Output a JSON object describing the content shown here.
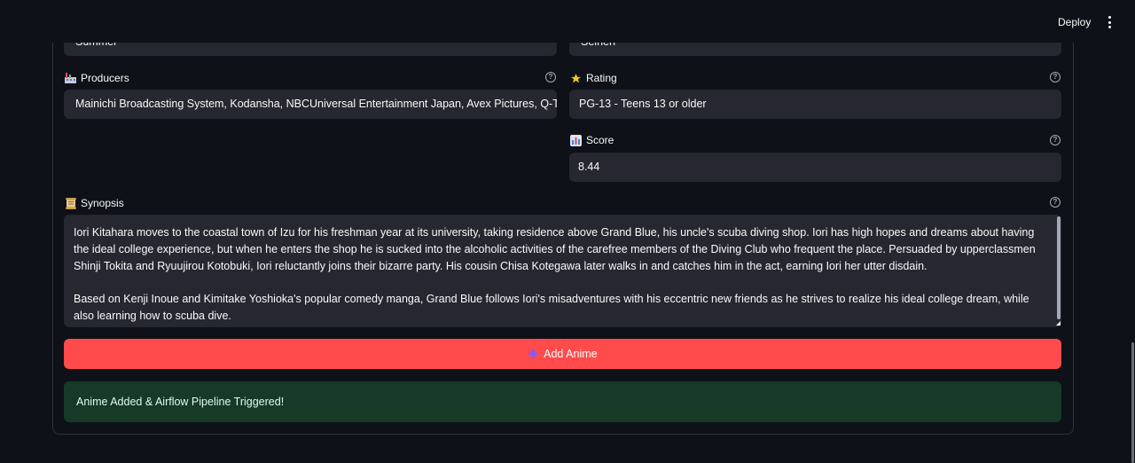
{
  "header": {
    "deploy_label": "Deploy"
  },
  "fields": {
    "season_value": "Summer",
    "demographic_value": "Seinen",
    "producers": {
      "icon": "factory-icon",
      "label": "Producers",
      "value": "Mainichi Broadcasting System, Kodansha, NBCUniversal Entertainment Japan, Avex Pictures, Q-Tec"
    },
    "rating": {
      "icon": "star-icon",
      "label": "Rating",
      "value": "PG-13 - Teens 13 or older"
    },
    "score": {
      "icon": "bar-chart-icon",
      "label": "Score",
      "value": "8.44"
    },
    "synopsis": {
      "icon": "scroll-icon",
      "label": "Synopsis",
      "paragraph1": "Iori Kitahara moves to the coastal town of Izu for his freshman year at its university, taking residence above Grand Blue, his uncle's scuba diving shop. Iori has high hopes and dreams about having the ideal college experience, but when he enters the shop he is sucked into the alcoholic activities of the carefree members of the Diving Club who frequent the place. Persuaded by upperclassmen Shinji Tokita and Ryuujirou Kotobuki, Iori reluctantly joins their bizarre party. His cousin Chisa Kotegawa later walks in and catches him in the act, earning Iori her utter disdain.",
      "paragraph2": "Based on Kenji Inoue and Kimitake Yoshioka's popular comedy manga, Grand Blue follows Iori's misadventures with his eccentric new friends as he strives to realize his ideal college dream, while also learning how to scuba dive."
    }
  },
  "actions": {
    "add_label": "Add Anime",
    "add_icon": "plus-icon"
  },
  "status": {
    "success_message": "Anime Added & Airflow Pipeline Triggered!"
  },
  "colors": {
    "background": "#0e1117",
    "input_bg": "#262730",
    "primary_button": "#ff4b4b",
    "success_bg": "#173928"
  }
}
